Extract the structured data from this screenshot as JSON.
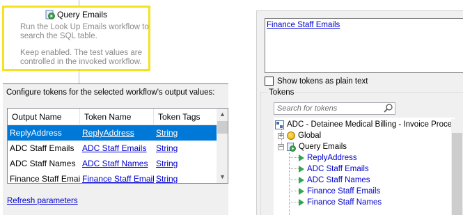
{
  "activity": {
    "title": "Query Emails",
    "description": "Run the Look Up Emails workflow to search the SQL table.",
    "note": "Keep enabled. The test values are controlled in the invoked workflow."
  },
  "config": {
    "label": "Configure tokens for the selected workflow's output values:",
    "columns": [
      "Output Name",
      "Token Name",
      "Token Tags"
    ],
    "rows": [
      {
        "output": "ReplyAddress",
        "token": "ReplyAddress",
        "tags": "String"
      },
      {
        "output": "ADC Staff Emails",
        "token": "ADC Staff Emails",
        "tags": "String"
      },
      {
        "output": "ADC Staff Names",
        "token": "ADC Staff Names",
        "tags": "String"
      },
      {
        "output": "Finance Staff Emails",
        "token": "Finance Staff Emails",
        "tags": "String"
      }
    ],
    "refresh_label": "Refresh parameters"
  },
  "right": {
    "value_token": "Finance Staff Emails",
    "show_plain_label": "Show tokens as plain text",
    "tokens_label": "Tokens",
    "search_placeholder": "Search for tokens",
    "tree": {
      "root": "ADC - Detainee Medical Billing - Invoice Proce",
      "global": "Global",
      "query": "Query Emails",
      "children": [
        "ReplyAddress",
        "ADC Staff Emails",
        "ADC Staff Names",
        "Finance Staff Emails",
        "Finance Staff Names"
      ]
    }
  },
  "colors": {
    "highlight_border": "#f5e11f",
    "selection": "#0078d7",
    "link": "#0000cc",
    "play_green": "#2ea84a"
  }
}
